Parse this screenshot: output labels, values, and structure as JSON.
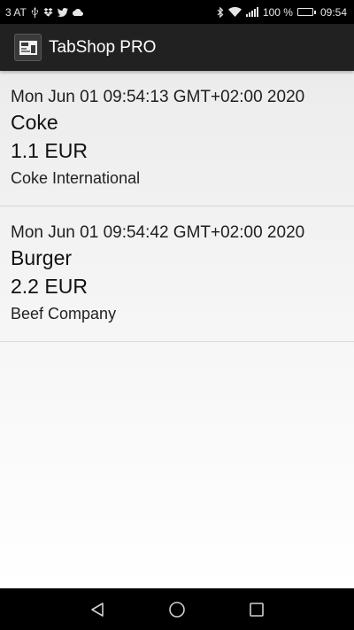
{
  "status_bar": {
    "carrier": "3 AT",
    "battery_percent": "100 %",
    "battery_level": 1.0,
    "time": "09:54",
    "icons": [
      "usb-icon",
      "dropbox-icon",
      "twitter-icon",
      "cloud-icon",
      "bluetooth-icon",
      "wifi-icon",
      "signal-icon",
      "battery-icon"
    ]
  },
  "app_bar": {
    "title": "TabShop PRO"
  },
  "items": [
    {
      "date": "Mon Jun 01 09:54:13 GMT+02:00 2020",
      "name": "Coke",
      "price": "1.1 EUR",
      "vendor": "Coke International"
    },
    {
      "date": "Mon Jun 01 09:54:42 GMT+02:00 2020",
      "name": "Burger",
      "price": "2.2 EUR",
      "vendor": "Beef Company"
    }
  ],
  "nav_bar": {
    "buttons": [
      "back-icon",
      "home-icon",
      "recents-icon"
    ]
  }
}
